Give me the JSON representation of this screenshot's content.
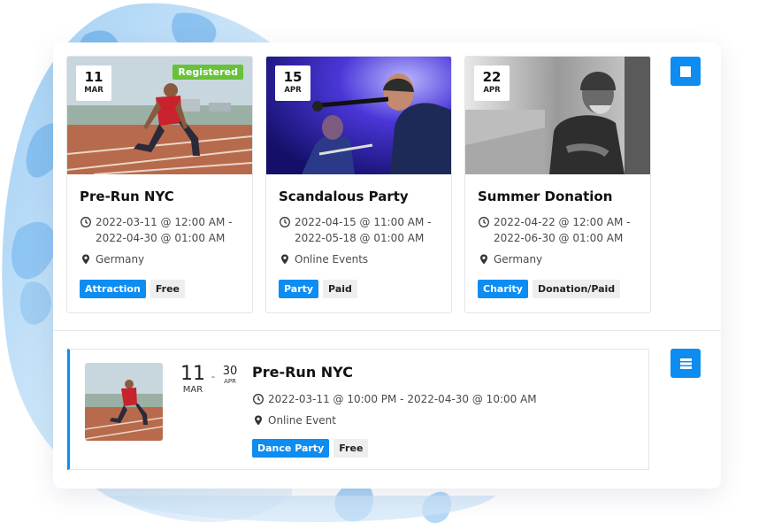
{
  "grid_events": [
    {
      "title": "Pre-Run NYC",
      "day": "11",
      "month": "MAR",
      "badge": "Registered",
      "datetime_line1": "2022-03-11 @ 12:00 AM -",
      "datetime_line2": "2022-04-30 @ 01:00 AM",
      "location": "Germany",
      "category_tag": "Attraction",
      "price_tag": "Free"
    },
    {
      "title": "Scandalous Party",
      "day": "15",
      "month": "APR",
      "datetime_line1": "2022-04-15 @ 11:00 AM -",
      "datetime_line2": "2022-05-18 @ 01:00 AM",
      "location": "Online Events",
      "category_tag": "Party",
      "price_tag": "Paid"
    },
    {
      "title": "Summer Donation",
      "day": "22",
      "month": "APR",
      "datetime_line1": "2022-04-22 @ 12:00 AM -",
      "datetime_line2": "2022-06-30 @ 01:00 AM",
      "location": "Germany",
      "category_tag": "Charity",
      "price_tag": "Donation/Paid"
    }
  ],
  "list_event": {
    "title": "Pre-Run NYC",
    "start_day": "11",
    "start_month": "MAR",
    "separator": "-",
    "end_day": "30",
    "end_month": "APR",
    "datetime": "2022-03-11 @ 10:00 PM - 2022-04-30 @ 10:00 AM",
    "location": "Online Event",
    "category_tag": "Dance Party",
    "price_tag": "Free"
  },
  "icons": {
    "grid_view": "grid-view-icon",
    "list_view": "list-view-icon",
    "clock": "clock-icon",
    "location": "map-pin-icon"
  },
  "colors": {
    "accent": "#0d8cf2",
    "registered": "#67c23a",
    "tag_gray": "#eeeeee"
  }
}
